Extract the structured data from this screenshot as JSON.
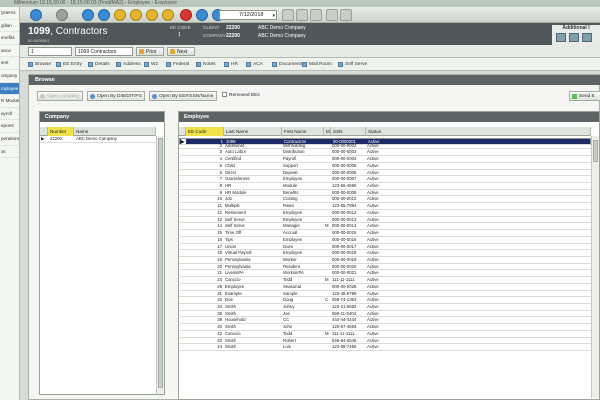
{
  "window": {
    "title": "Millennium 18.15.00.06 · 18.15.00.03 (Prod/MA2) - Employee - Employee"
  },
  "leftnav": {
    "items": [
      {
        "label": "ystems"
      },
      {
        "label": "gillan"
      },
      {
        "label": "enefits"
      },
      {
        "label": "ance"
      },
      {
        "label": "ient"
      },
      {
        "label": "ompany"
      },
      {
        "label": "mployee",
        "active": true
      },
      {
        "label": "R Module"
      },
      {
        "label": "ayroll"
      },
      {
        "label": "eports"
      },
      {
        "label": "perations"
      },
      {
        "label": "xit"
      }
    ]
  },
  "toolbar": {
    "date_value": "7/12/2018",
    "buttons": [
      {
        "icon": "back-icon",
        "color": "#3a8ad6"
      },
      {
        "icon": "forward-icon",
        "color": "#9aa3a0"
      },
      {
        "icon": "home-icon",
        "color": "#3a8ad6"
      },
      {
        "icon": "info-icon",
        "color": "#3a8ad6"
      },
      {
        "icon": "help-icon",
        "color": "#e7b52b"
      },
      {
        "icon": "notes-icon",
        "color": "#e7b52b"
      },
      {
        "icon": "alert-icon",
        "color": "#e7b52b"
      },
      {
        "icon": "user-icon",
        "color": "#e7b52b"
      },
      {
        "icon": "stop-icon",
        "color": "#d6362b"
      },
      {
        "icon": "lock-icon",
        "color": "#3a8ad6"
      },
      {
        "icon": "refresh-icon",
        "color": "#3a8ad6"
      }
    ]
  },
  "header": {
    "title_number": "1099",
    "title_name": ", Contractors",
    "id_line": "00-0000001",
    "ee_code_label": "EE CODE",
    "ee_code_value": "1",
    "client_label": "CLIENT",
    "client_value": "22200",
    "company_label": "COMPANY",
    "company_value": "22200",
    "company_name": "ABC Demo Company",
    "client_name": "ABC Demo Company",
    "additional_label": "Additional I"
  },
  "navrow": {
    "select1": "1",
    "select2": "1099 Contractors",
    "prior_label": "Prior",
    "next_label": "Next"
  },
  "tabs": [
    {
      "label": "Browse"
    },
    {
      "label": "EE Entry"
    },
    {
      "label": "Details"
    },
    {
      "label": "Address"
    },
    {
      "label": "W2"
    },
    {
      "label": "Federal"
    },
    {
      "label": "Notes"
    },
    {
      "label": "HR"
    },
    {
      "label": "ACA"
    },
    {
      "label": "Documents"
    },
    {
      "label": "Mail Room"
    },
    {
      "label": "Self Serve"
    }
  ],
  "browse": {
    "title": "Browse",
    "open_company_label": "Open company",
    "open_dob_label": "Open By D/B/D/T/PS",
    "open_ssn_label": "Open By EE#/SSN/Name",
    "removed_label": "Removed EEs",
    "send_label": "Send E"
  },
  "company": {
    "title": "Company",
    "columns": [
      "Number",
      "Name"
    ],
    "rows": [
      {
        "number": "22200",
        "name": "ABC Demo Company"
      }
    ]
  },
  "employee": {
    "title": "Employee",
    "columns": [
      "EE Code",
      "Last Name",
      "First Name",
      "MI",
      "SSN",
      "Status"
    ],
    "rows": [
      {
        "code": "1",
        "last": "1099",
        "first": "Contractors",
        "mi": "",
        "ssn": "00-0000001",
        "status": "Active"
      },
      {
        "code": "2",
        "last": "Additional",
        "first": "Withholding",
        "mi": "",
        "ssn": "000-00-0002",
        "status": "Active"
      },
      {
        "code": "3",
        "last": "Auto Labor",
        "first": "Distribution",
        "mi": "",
        "ssn": "000-00-0003",
        "status": "Active"
      },
      {
        "code": "4",
        "last": "Certified",
        "first": "Payroll",
        "mi": "",
        "ssn": "000-00-0004",
        "status": "Active"
      },
      {
        "code": "5",
        "last": "Child",
        "first": "Support",
        "mi": "",
        "ssn": "000-00-0005",
        "status": "Active"
      },
      {
        "code": "6",
        "last": "Direct",
        "first": "Deposit",
        "mi": "",
        "ssn": "000-00-0006",
        "status": "Active"
      },
      {
        "code": "7",
        "last": "Garnishment",
        "first": "Employee",
        "mi": "",
        "ssn": "000-00-0007",
        "status": "Active"
      },
      {
        "code": "8",
        "last": "HR",
        "first": "Module",
        "mi": "",
        "ssn": "123-56-4695",
        "status": "Active"
      },
      {
        "code": "9",
        "last": "HR Module",
        "first": "Benefits",
        "mi": "",
        "ssn": "000-00-0009",
        "status": "Active"
      },
      {
        "code": "10",
        "last": "Job",
        "first": "Costing",
        "mi": "",
        "ssn": "000-00-0010",
        "status": "Active"
      },
      {
        "code": "11",
        "last": "Multiple",
        "first": "Rates",
        "mi": "",
        "ssn": "123-65-7894",
        "status": "Active"
      },
      {
        "code": "12",
        "last": "Retirement",
        "first": "Employee",
        "mi": "",
        "ssn": "000-00-0012",
        "status": "Active"
      },
      {
        "code": "13",
        "last": "Self Serve",
        "first": "Employee",
        "mi": "",
        "ssn": "000-00-0013",
        "status": "Active"
      },
      {
        "code": "14",
        "last": "Self Serve",
        "first": "Manager",
        "mi": "M",
        "ssn": "000-00-0014",
        "status": "Active"
      },
      {
        "code": "15",
        "last": "Time Off",
        "first": "Accrual",
        "mi": "",
        "ssn": "000-00-0015",
        "status": "Active"
      },
      {
        "code": "16",
        "last": "Tips",
        "first": "Employee",
        "mi": "",
        "ssn": "000-00-0016",
        "status": "Active"
      },
      {
        "code": "17",
        "last": "Union",
        "first": "Dues",
        "mi": "",
        "ssn": "000-00-0017",
        "status": "Active"
      },
      {
        "code": "18",
        "last": "Virtual Payroll",
        "first": "Employee",
        "mi": "",
        "ssn": "000-00-0018",
        "status": "Active"
      },
      {
        "code": "19",
        "last": "Pennsylvania",
        "first": "Worker",
        "mi": "",
        "ssn": "000-00-0019",
        "status": "Active"
      },
      {
        "code": "20",
        "last": "Pennsylvania",
        "first": "Resident",
        "mi": "",
        "ssn": "000-00-0020",
        "status": "Active"
      },
      {
        "code": "21",
        "last": "LivesinPA",
        "first": "WorksinPA",
        "mi": "",
        "ssn": "000-00-0021",
        "status": "Active"
      },
      {
        "code": "24",
        "last": "Canccio",
        "first": "Todd",
        "mi": "M",
        "ssn": "111-11-1111",
        "status": "Active"
      },
      {
        "code": "28",
        "last": "Employee",
        "first": "Seasonal",
        "mi": "",
        "ssn": "000-00-0028",
        "status": "Active"
      },
      {
        "code": "31",
        "last": "Example",
        "first": "Sample",
        "mi": "",
        "ssn": "123-45-6789",
        "status": "Active"
      },
      {
        "code": "33",
        "last": "Doe",
        "first": "Doug",
        "mi": "C",
        "ssn": "259-74-1363",
        "status": "Active"
      },
      {
        "code": "34",
        "last": "Smith",
        "first": "Johny",
        "mi": "",
        "ssn": "123-21-5682",
        "status": "Active"
      },
      {
        "code": "35",
        "last": "Smith",
        "first": "Joe",
        "mi": "",
        "ssn": "559-11-5404",
        "status": "Active"
      },
      {
        "code": "39",
        "last": "Household",
        "first": "CC",
        "mi": "",
        "ssn": "444-44-4444",
        "status": "Active"
      },
      {
        "code": "40",
        "last": "Smith",
        "first": "John",
        "mi": "",
        "ssn": "125-57-4693",
        "status": "Active"
      },
      {
        "code": "42",
        "last": "Canccio",
        "first": "Todd",
        "mi": "M",
        "ssn": "111-11-1111",
        "status": "Active"
      },
      {
        "code": "43",
        "last": "Smith",
        "first": "Robert",
        "mi": "",
        "ssn": "546-54-6546",
        "status": "Active"
      },
      {
        "code": "44",
        "last": "Smith",
        "first": "Lois",
        "mi": "",
        "ssn": "123-98-7456",
        "status": "Active"
      }
    ]
  }
}
